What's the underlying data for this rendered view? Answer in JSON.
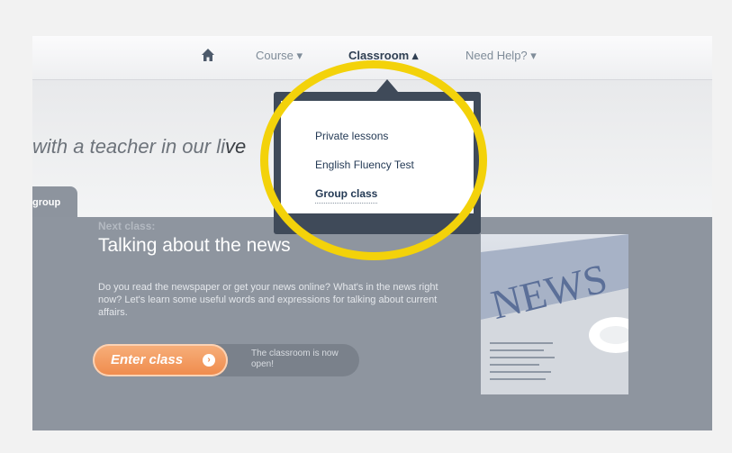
{
  "nav": {
    "home_icon": "home-icon",
    "course": "Course",
    "classroom": "Classroom",
    "need_help": "Need Help?",
    "caret_down": "▾",
    "caret_up": "▴"
  },
  "hero": {
    "text": "with a teacher in our li",
    "overlap_text": "ve"
  },
  "tabs": {
    "group": "group"
  },
  "dropdown": {
    "items": [
      "Private lessons",
      "English Fluency Test",
      "Group class"
    ],
    "active_index": 2
  },
  "next_class": {
    "label": "Next class:",
    "title": "Talking about the news",
    "description": "Do you read the newspaper or get your news online? What's in the news right now? Let's learn some useful words and expressions for talking about current affairs.",
    "enter_label": "Enter class",
    "enter_icon": "chevron-right-circle-icon",
    "status": "The classroom is now open!"
  },
  "image": {
    "word": "NEWS"
  },
  "colors": {
    "highlight": "#f3d20a",
    "cta": "#ef8a4b",
    "dropdown_frame": "#3f4a59",
    "content_bg": "#8e959f"
  }
}
